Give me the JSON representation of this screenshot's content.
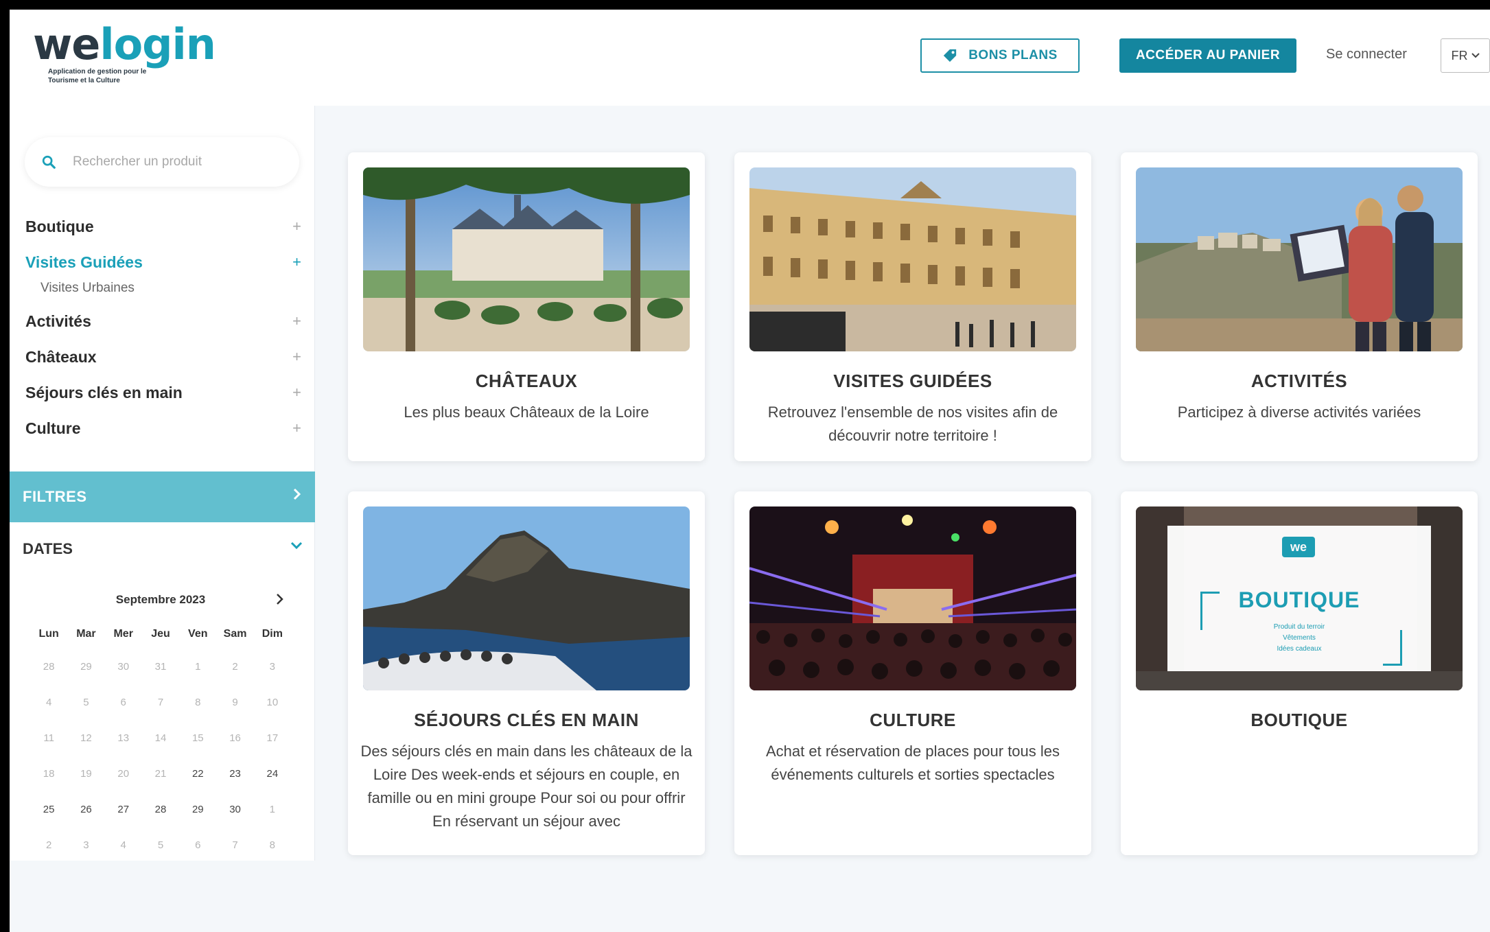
{
  "header": {
    "logo_we": "we",
    "logo_login": "login",
    "logo_tagline": "Application de gestion pour le Tourisme et la Culture",
    "bons_plans_label": "BONS PLANS",
    "panier_label": "ACCÉDER AU PANIER",
    "connect_label": "Se connecter",
    "lang_value": "FR"
  },
  "sidebar": {
    "search_placeholder": "Rechercher un produit",
    "menu": [
      {
        "label": "Boutique",
        "expander": "+"
      },
      {
        "label": "Visites Guidées",
        "expander": "+"
      },
      {
        "label": "Visites Urbaines"
      },
      {
        "label": "Activités",
        "expander": "+"
      },
      {
        "label": "Châteaux",
        "expander": "+"
      },
      {
        "label": "Séjours clés en main",
        "expander": "+"
      },
      {
        "label": "Culture",
        "expander": "+"
      }
    ],
    "filtres_label": "FILTRES",
    "dates_label": "DATES"
  },
  "calendar": {
    "month": "Septembre 2023",
    "weekdays": [
      "Lun",
      "Mar",
      "Mer",
      "Jeu",
      "Ven",
      "Sam",
      "Dim"
    ],
    "weeks": [
      [
        "28",
        "29",
        "30",
        "31",
        "1",
        "2",
        "3"
      ],
      [
        "4",
        "5",
        "6",
        "7",
        "8",
        "9",
        "10"
      ],
      [
        "11",
        "12",
        "13",
        "14",
        "15",
        "16",
        "17"
      ],
      [
        "18",
        "19",
        "20",
        "21",
        "22",
        "23",
        "24"
      ],
      [
        "25",
        "26",
        "27",
        "28",
        "29",
        "30",
        "1"
      ],
      [
        "2",
        "3",
        "4",
        "5",
        "6",
        "7",
        "8"
      ]
    ]
  },
  "cards": [
    {
      "title": "CHÂTEAUX",
      "desc": "Les plus beaux Châteaux de la Loire"
    },
    {
      "title": "VISITES GUIDÉES",
      "desc": "Retrouvez l'ensemble de nos visites afin de découvrir notre territoire !"
    },
    {
      "title": "ACTIVITÉS",
      "desc": "Participez à diverse activités variées"
    },
    {
      "title": "SÉJOURS CLÉS EN MAIN",
      "desc": "Des séjours clés en main dans les châteaux de la Loire Des week-ends et séjours en couple, en famille ou en mini groupe Pour soi ou pour offrir En réservant un séjour avec"
    },
    {
      "title": "CULTURE",
      "desc": "Achat et réservation de places pour tous les événements culturels et sorties spectacles"
    },
    {
      "title": "BOUTIQUE",
      "desc": ""
    }
  ],
  "boutique_image": {
    "badge": "we",
    "word": "BOUTIQUE",
    "lines": [
      "Produit du terroir",
      "Vêtements",
      "Idées cadeaux"
    ]
  },
  "colors": {
    "accent": "#1aa0b8",
    "button": "#14869f",
    "filtres_bg": "#62bfcf",
    "background": "#f4f7fa"
  }
}
